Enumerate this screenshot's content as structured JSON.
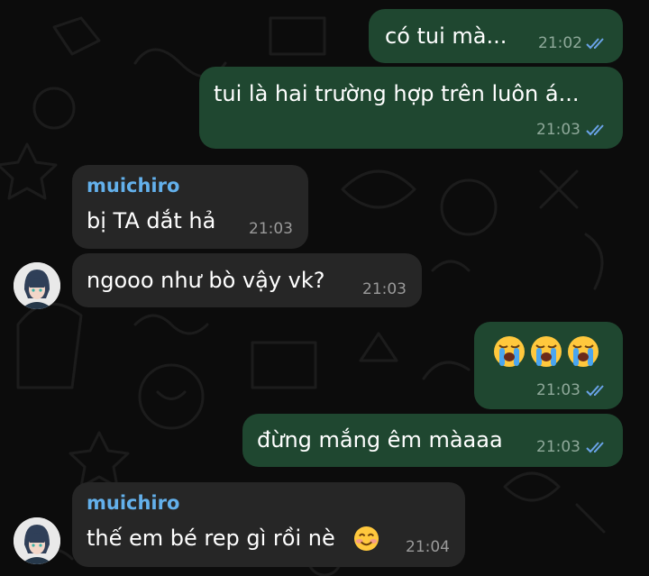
{
  "chat": {
    "messages": [
      {
        "direction": "out",
        "text": "có tui mà...",
        "time": "21:02",
        "status": "read"
      },
      {
        "direction": "out",
        "text": "tui là hai trường hợp trên luôn á...",
        "time": "21:03",
        "status": "read"
      },
      {
        "direction": "in",
        "sender": "muichiro",
        "text": "bị TA dắt hả",
        "time": "21:03"
      },
      {
        "direction": "in",
        "text": "ngooo như bò vậy vk?",
        "time": "21:03",
        "avatar": "muichiro-avatar"
      },
      {
        "direction": "out",
        "emoji": [
          "loudly-crying-face",
          "loudly-crying-face",
          "loudly-crying-face"
        ],
        "time": "21:03",
        "status": "read"
      },
      {
        "direction": "out",
        "text": "đừng mắng êm màaaa",
        "time": "21:03",
        "status": "read"
      },
      {
        "direction": "in",
        "sender": "muichiro",
        "text": "thế em bé rep gì rồi nè",
        "emoji": "smiling-face-with-smiling-eyes",
        "time": "21:04",
        "avatar": "muichiro-avatar"
      }
    ]
  },
  "colors": {
    "background": "#0c0c0c",
    "outgoing_bubble": "#1f4730",
    "incoming_bubble": "#262626",
    "sender_name": "#63b0eb",
    "read_ticks": "#6aa3e8"
  }
}
